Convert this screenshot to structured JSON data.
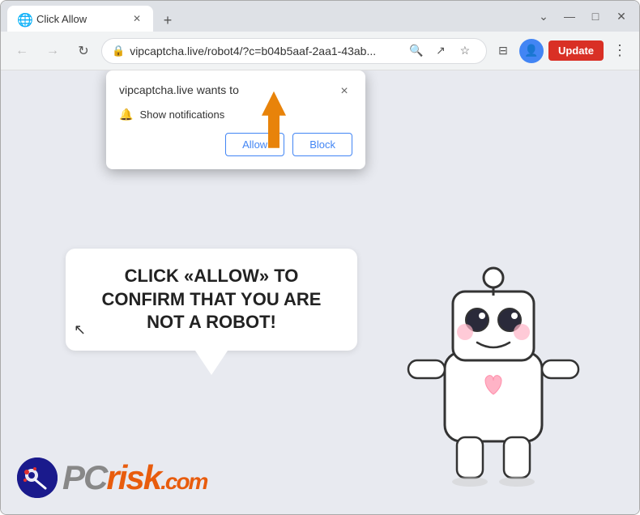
{
  "browser": {
    "tab": {
      "title": "Click Allow",
      "favicon": "🌐"
    },
    "new_tab_label": "+",
    "window_controls": {
      "minimize": "—",
      "maximize": "□",
      "close": "✕"
    }
  },
  "navbar": {
    "back_label": "←",
    "forward_label": "→",
    "reload_label": "↻",
    "url": "vipcaptcha.live/robot4/?c=b04b5aaf-2aa1-43ab...",
    "search_icon": "🔍",
    "share_icon": "↗",
    "star_icon": "☆",
    "sidebar_icon": "⊟",
    "profile_icon": "👤",
    "update_label": "Update",
    "more_icon": "⋮"
  },
  "popup": {
    "site_text": "vipcaptcha.live wants to",
    "close_label": "×",
    "notification_label": "Show notifications",
    "allow_label": "Allow",
    "block_label": "Block"
  },
  "speech_bubble": {
    "text": "CLICK «ALLOW» TO CONFIRM THAT YOU ARE NOT A ROBOT!"
  },
  "logo": {
    "pc_text": "PC",
    "risk_text": "risk",
    "domain": ".com"
  },
  "colors": {
    "allow_color": "#4285f4",
    "block_color": "#4285f4",
    "arrow_color": "#e8830a",
    "update_btn": "#d93025"
  }
}
